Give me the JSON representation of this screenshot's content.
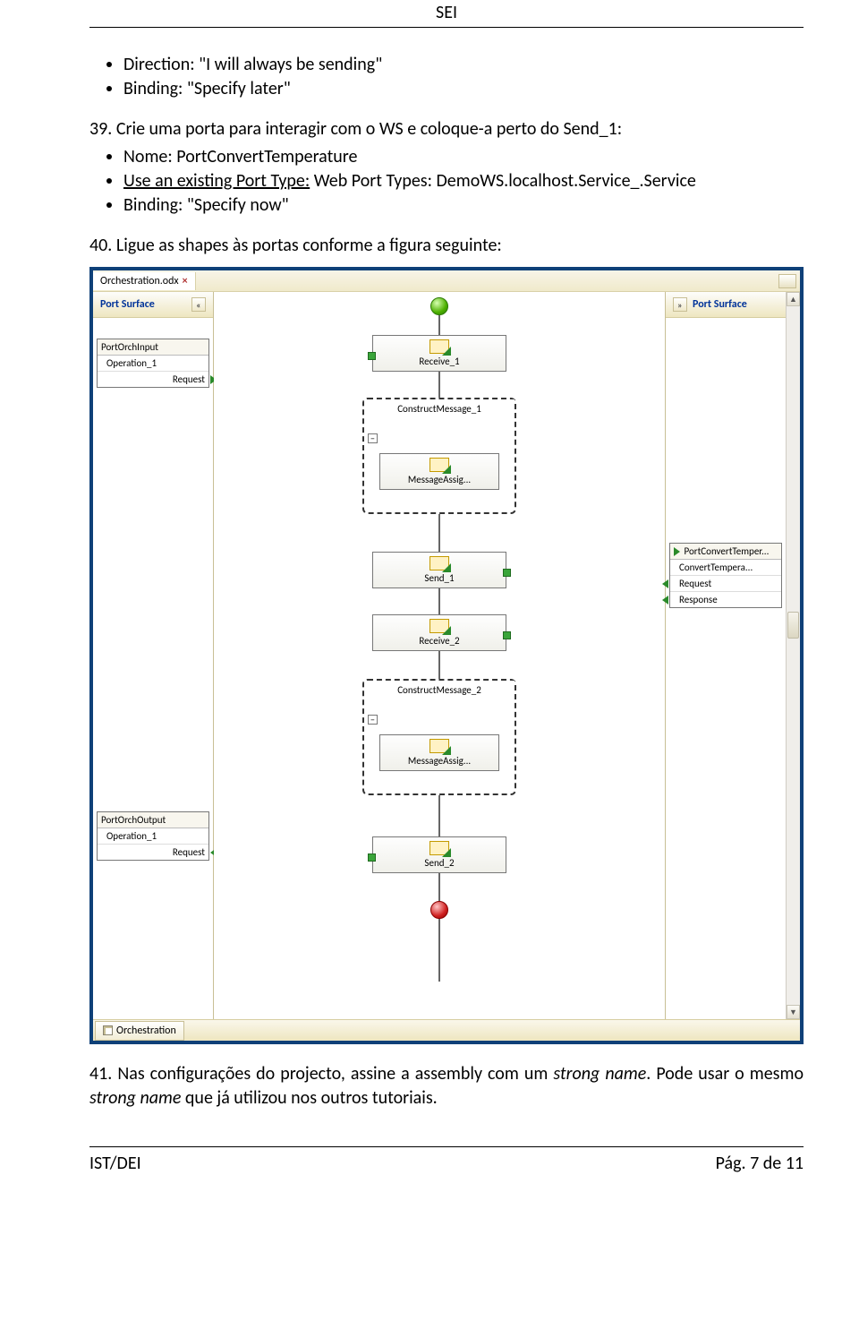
{
  "header": {
    "title": "SEI"
  },
  "bullets_top": [
    "Direction: \"I will always be sending\"",
    "Binding: \"Specify later\""
  ],
  "step39_intro": "39. Crie uma porta para interagir com o WS e coloque-a perto do Send_1:",
  "bullets_39": {
    "nome": "Nome: PortConvertTemperature",
    "use_existing_label": "Use an existing Port Type:",
    "use_existing_value": "Web Port Types: DemoWS.localhost.Service_.Service",
    "binding": "Binding: \"Specify now\""
  },
  "step40": "40. Ligue as shapes às portas conforme a figura seguinte:",
  "step41_a": "41. Nas configurações do projecto, assine a assembly com um ",
  "step41_strong1": "strong name",
  "step41_b": ". Pode usar o mesmo ",
  "step41_strong2": "strong name",
  "step41_c": " que já utilizou nos outros tutoriais.",
  "footer": {
    "left": "IST/DEI",
    "right": "Pág. 7 de 11"
  },
  "screenshot": {
    "tab": "Orchestration.odx",
    "surface_left_header": "Port Surface",
    "surface_right_header": "Port Surface",
    "bottom_tab": "Orchestration",
    "port_input": {
      "title": "PortOrchInput",
      "op": "Operation_1",
      "req": "Request"
    },
    "port_output": {
      "title": "PortOrchOutput",
      "op": "Operation_1",
      "req": "Request"
    },
    "port_convert": {
      "title": "PortConvertTemper...",
      "op": "ConvertTempera...",
      "req": "Request",
      "resp": "Response"
    },
    "shapes": {
      "receive1": "Receive_1",
      "construct1": "ConstructMessage_1",
      "msgassig1": "MessageAssig...",
      "send1": "Send_1",
      "receive2": "Receive_2",
      "construct2": "ConstructMessage_2",
      "msgassig2": "MessageAssig...",
      "send2": "Send_2"
    }
  }
}
